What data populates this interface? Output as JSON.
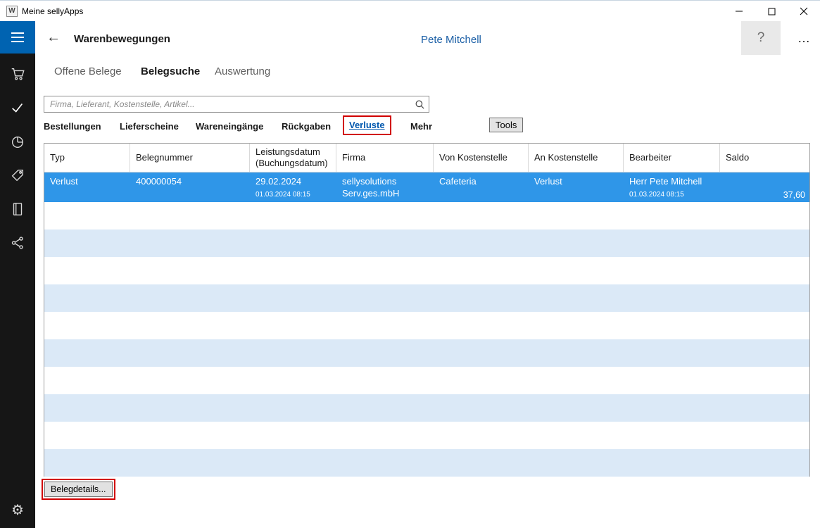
{
  "window": {
    "title": "Meine sellyApps"
  },
  "header": {
    "title": "Warenbewegungen",
    "user_name": "Pete Mitchell"
  },
  "icons": {
    "app": "W",
    "back": "←",
    "help": "?",
    "more": "…",
    "settings": "⚙"
  },
  "nav_tabs": [
    {
      "label": "Offene Belege"
    },
    {
      "label": "Belegsuche"
    },
    {
      "label": "Auswertung"
    }
  ],
  "search": {
    "placeholder": "Firma, Lieferant, Kostenstelle, Artikel..."
  },
  "filter_tabs": [
    {
      "label": "Bestellungen"
    },
    {
      "label": "Lieferscheine"
    },
    {
      "label": "Wareneingänge"
    },
    {
      "label": "Rückgaben"
    },
    {
      "label": "Verluste"
    },
    {
      "label": "Mehr"
    }
  ],
  "tools_button": "Tools",
  "table": {
    "columns": [
      {
        "label": "Typ"
      },
      {
        "label": "Belegnummer"
      },
      {
        "label": "Leistungsdatum",
        "sublabel": "(Buchungsdatum)"
      },
      {
        "label": "Firma"
      },
      {
        "label": "Von Kostenstelle"
      },
      {
        "label": "An Kostenstelle"
      },
      {
        "label": "Bearbeiter"
      },
      {
        "label": "Saldo"
      }
    ],
    "selected_row": {
      "typ": "Verlust",
      "belegnummer": "400000054",
      "leistungsdatum": "29.02.2024",
      "buchungsdatum": "01.03.2024 08:15",
      "firma_line1": "sellysolutions",
      "firma_line2": "Serv.ges.mbH",
      "von_kostenstelle": "Cafeteria",
      "an_kostenstelle": "Verlust",
      "bearbeiter": "Herr Pete Mitchell",
      "bearbeiter_datum": "01.03.2024 08:15",
      "saldo": "37,60"
    }
  },
  "footer": {
    "details_button": "Belegdetails..."
  },
  "colors": {
    "accent_blue": "#0063b1",
    "selected_row_blue": "#2f96e8",
    "stripe_blue": "#dbe9f7",
    "annotation_red": "#d10000",
    "user_blue": "#1b5fa6",
    "link_blue": "#0057ae",
    "sidebar_dark": "#161616"
  }
}
